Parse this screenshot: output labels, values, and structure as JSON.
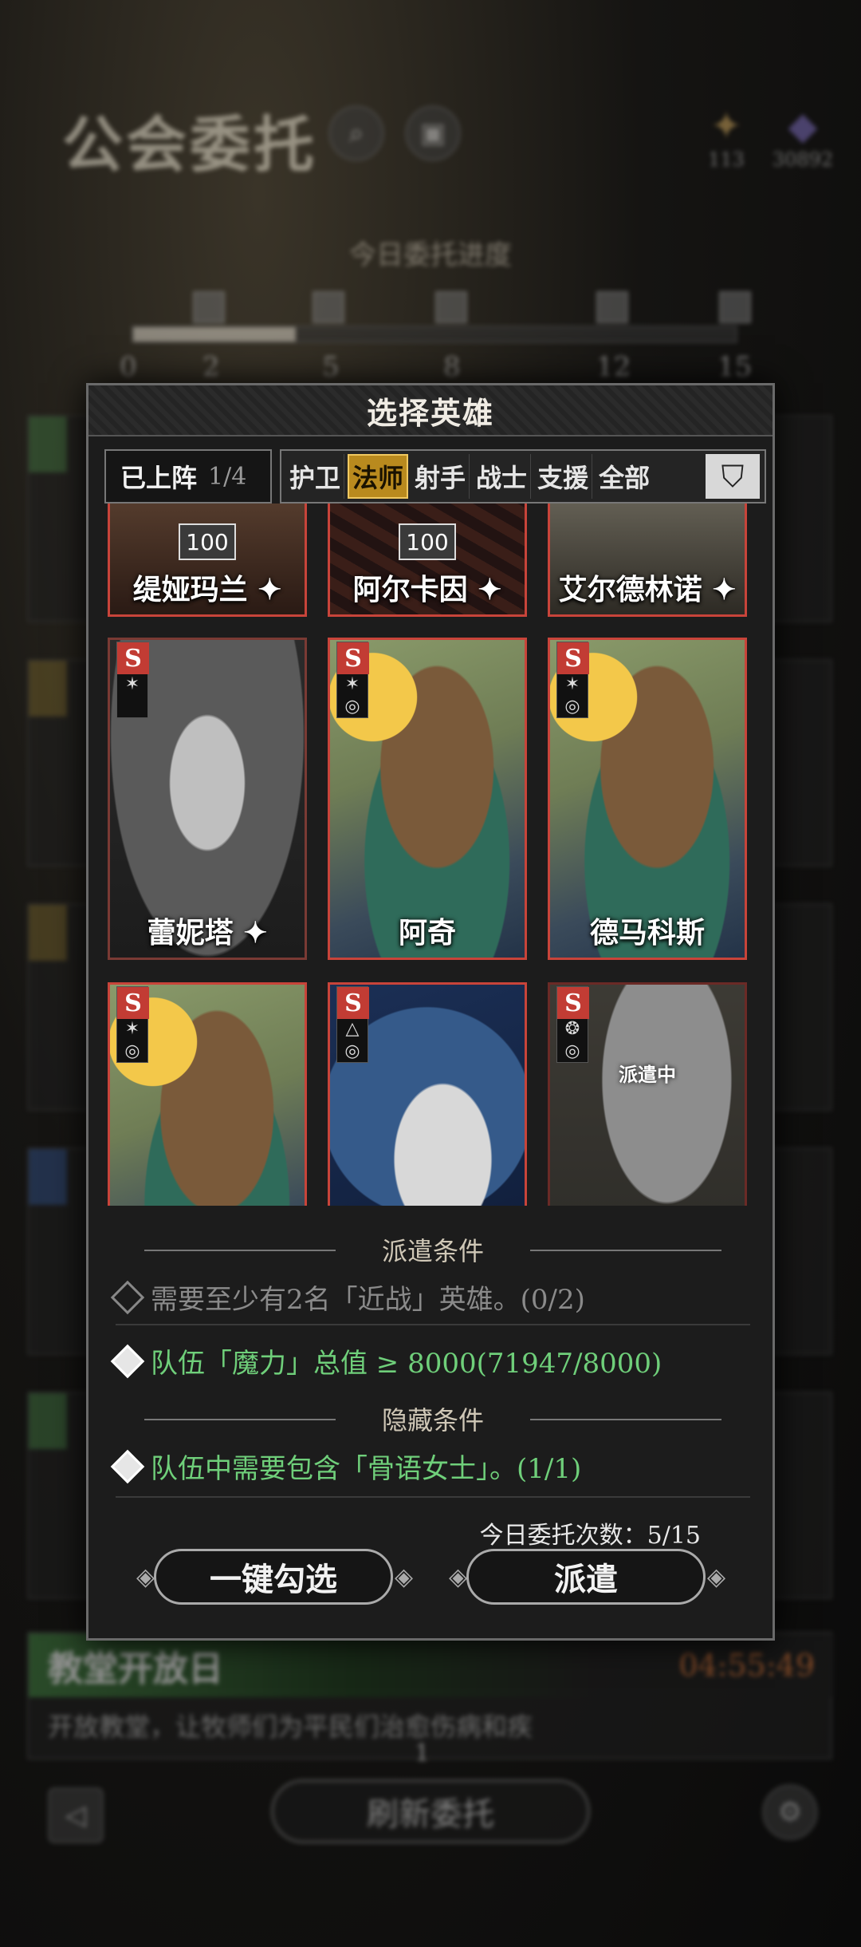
{
  "background": {
    "page_title": "公会委托",
    "progress_title": "今日委托进度",
    "ticks": [
      "0",
      "2",
      "5",
      "8",
      "12",
      "15"
    ],
    "progress_fraction": 0.27,
    "resources": [
      {
        "icon": "scroll-icon",
        "value": "113"
      },
      {
        "icon": "crystal-icon",
        "value": "30892"
      }
    ],
    "last_task": {
      "title": "教堂开放日",
      "timer": "04:55:49",
      "desc": "开放教堂，让牧师们为平民们治愈伤病和疾"
    },
    "refresh_button": "刷新委托",
    "refresh_cost": "1"
  },
  "modal": {
    "title": "选择英雄",
    "lineup": {
      "label": "已上阵",
      "count": "1/4"
    },
    "tabs": [
      "护卫",
      "法师",
      "射手",
      "战士",
      "支援",
      "全部"
    ],
    "active_tab": "法师",
    "heroes": [
      {
        "name": "缇娅玛兰",
        "star": "✦",
        "level": "100"
      },
      {
        "name": "阿尔卡因",
        "star": "✦",
        "level": "100"
      },
      {
        "name": "艾尔德林诺",
        "star": "✦",
        "level": ""
      },
      {
        "name": "蕾妮塔",
        "star": "✦",
        "level": ""
      },
      {
        "name": "阿奇",
        "star": "",
        "level": ""
      },
      {
        "name": "德马科斯",
        "star": "",
        "level": ""
      },
      {
        "name": "",
        "star": "",
        "level": ""
      },
      {
        "name": "",
        "star": "",
        "level": ""
      },
      {
        "name": "",
        "star": "",
        "level": "",
        "status": "派遣中"
      }
    ],
    "dispatch_title": "派遣条件",
    "conditions": [
      {
        "text": "需要至少有2名「近战」英雄。(0/2)",
        "met": false
      },
      {
        "text": "队伍「魔力」总值 ≥ 8000(71947/8000)",
        "met": true
      }
    ],
    "hidden_title": "隐藏条件",
    "hidden_conditions": [
      {
        "text": "队伍中需要包含「骨语女士」。(1/1)",
        "met": true
      }
    ],
    "daily_count": "今日委托次数：5/15",
    "auto_select": "一键勾选",
    "dispatch": "派遣"
  }
}
